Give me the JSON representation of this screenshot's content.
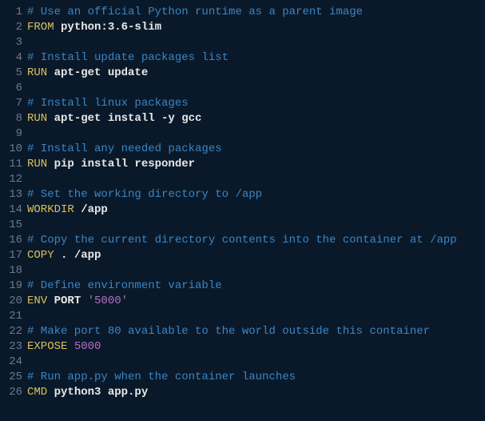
{
  "code": {
    "lines": [
      {
        "n": "1",
        "tokens": [
          {
            "cls": "tok-comment",
            "t": "# Use an official Python runtime as a parent image"
          }
        ]
      },
      {
        "n": "2",
        "tokens": [
          {
            "cls": "tok-keyword",
            "t": "FROM "
          },
          {
            "cls": "tok-text",
            "t": "python:3.6-slim"
          }
        ]
      },
      {
        "n": "3",
        "tokens": []
      },
      {
        "n": "4",
        "tokens": [
          {
            "cls": "tok-comment",
            "t": "# Install update packages list"
          }
        ]
      },
      {
        "n": "5",
        "tokens": [
          {
            "cls": "tok-keyword",
            "t": "RUN "
          },
          {
            "cls": "tok-text",
            "t": "apt-get update"
          }
        ]
      },
      {
        "n": "6",
        "tokens": []
      },
      {
        "n": "7",
        "tokens": [
          {
            "cls": "tok-comment",
            "t": "# Install linux packages"
          }
        ]
      },
      {
        "n": "8",
        "tokens": [
          {
            "cls": "tok-keyword",
            "t": "RUN "
          },
          {
            "cls": "tok-text",
            "t": "apt-get install -y gcc"
          }
        ]
      },
      {
        "n": "9",
        "tokens": []
      },
      {
        "n": "10",
        "tokens": [
          {
            "cls": "tok-comment",
            "t": "# Install any needed packages"
          }
        ]
      },
      {
        "n": "11",
        "tokens": [
          {
            "cls": "tok-keyword",
            "t": "RUN "
          },
          {
            "cls": "tok-text",
            "t": "pip install responder"
          }
        ]
      },
      {
        "n": "12",
        "tokens": []
      },
      {
        "n": "13",
        "tokens": [
          {
            "cls": "tok-comment",
            "t": "# Set the working directory to /app"
          }
        ]
      },
      {
        "n": "14",
        "tokens": [
          {
            "cls": "tok-keyword",
            "t": "WORKDIR "
          },
          {
            "cls": "tok-text",
            "t": "/app"
          }
        ]
      },
      {
        "n": "15",
        "tokens": []
      },
      {
        "n": "16",
        "tokens": [
          {
            "cls": "tok-comment",
            "t": "# Copy the current directory contents into the container at /app"
          }
        ]
      },
      {
        "n": "17",
        "tokens": [
          {
            "cls": "tok-keyword",
            "t": "COPY "
          },
          {
            "cls": "tok-text",
            "t": ". /app"
          }
        ]
      },
      {
        "n": "18",
        "tokens": []
      },
      {
        "n": "19",
        "tokens": [
          {
            "cls": "tok-comment",
            "t": "# Define environment variable"
          }
        ]
      },
      {
        "n": "20",
        "tokens": [
          {
            "cls": "tok-keyword",
            "t": "ENV "
          },
          {
            "cls": "tok-text",
            "t": "PORT "
          },
          {
            "cls": "tok-string",
            "t": "'5000'"
          }
        ]
      },
      {
        "n": "21",
        "tokens": []
      },
      {
        "n": "22",
        "tokens": [
          {
            "cls": "tok-comment",
            "t": "# Make port 80 available to the world outside this container"
          }
        ]
      },
      {
        "n": "23",
        "tokens": [
          {
            "cls": "tok-expose",
            "t": "EXPOSE "
          },
          {
            "cls": "tok-string",
            "t": "5000"
          }
        ]
      },
      {
        "n": "24",
        "tokens": []
      },
      {
        "n": "25",
        "tokens": [
          {
            "cls": "tok-comment",
            "t": "# Run app.py when the container launches"
          }
        ]
      },
      {
        "n": "26",
        "tokens": [
          {
            "cls": "tok-keyword",
            "t": "CMD "
          },
          {
            "cls": "tok-text",
            "t": "python3 app.py"
          }
        ]
      }
    ]
  }
}
